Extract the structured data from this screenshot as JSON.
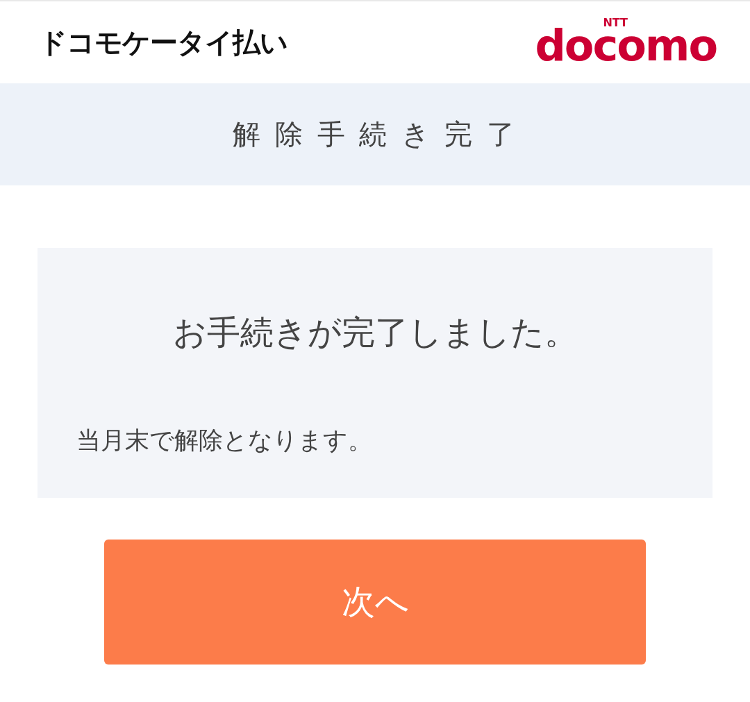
{
  "header": {
    "service_name": "ドコモケータイ払い",
    "logo": {
      "superscript": "NTT",
      "wordmark": "docomo"
    }
  },
  "title": "解 除 手 続 き 完 了",
  "message": {
    "heading": "お手続きが完了しました。",
    "body": "当月末で解除となります。"
  },
  "buttons": [
    "次へ"
  ]
}
